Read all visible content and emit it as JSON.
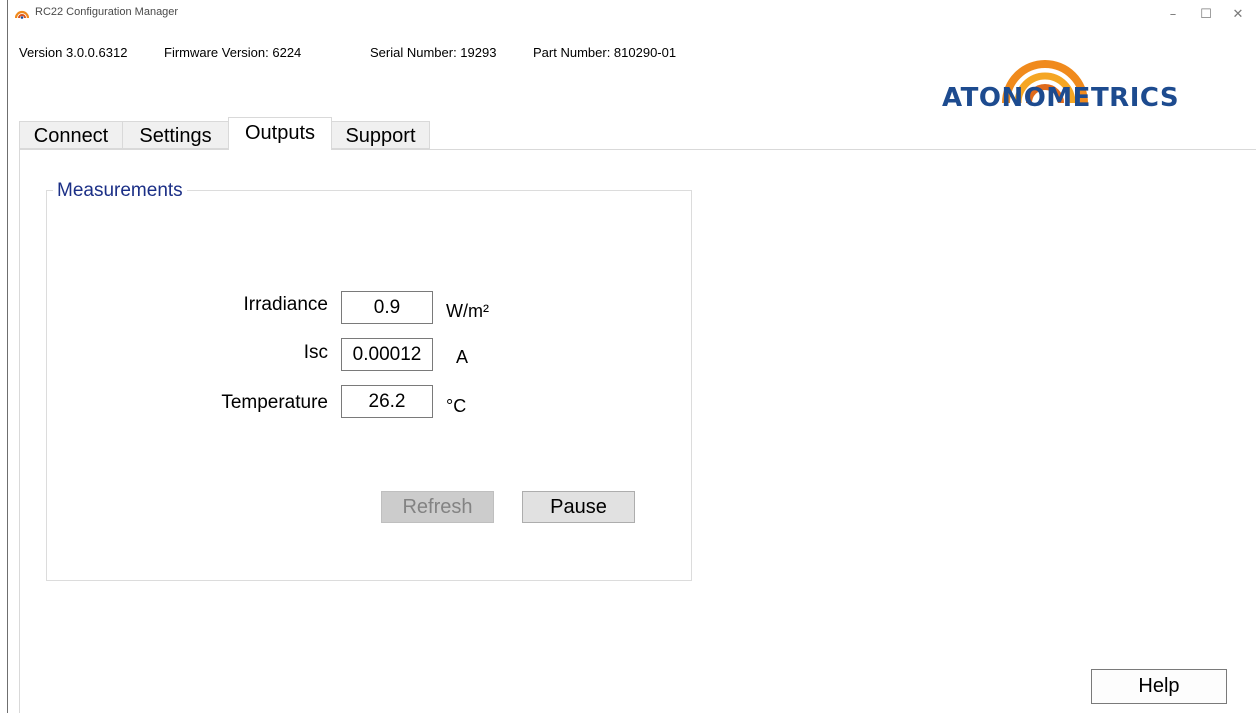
{
  "window": {
    "title": "RC22 Configuration Manager",
    "minimize": "–",
    "maximize": "☐",
    "close": "✕"
  },
  "info": {
    "version": "Version 3.0.0.6312",
    "firmware": "Firmware Version: 6224",
    "serial": "Serial Number: 19293",
    "part": "Part Number: 810290-01"
  },
  "logo": {
    "text": "ATONOMETRICS"
  },
  "tabs": [
    {
      "label": "Connect",
      "active": false
    },
    {
      "label": "Settings",
      "active": false
    },
    {
      "label": "Outputs",
      "active": true
    },
    {
      "label": "Support",
      "active": false
    }
  ],
  "measurements": {
    "title": "Measurements",
    "irradiance": {
      "label": "Irradiance",
      "value": "0.9",
      "unit": "W/m²"
    },
    "isc": {
      "label": "Isc",
      "value": "0.00012",
      "unit": "A"
    },
    "temperature": {
      "label": "Temperature",
      "value": "26.2",
      "unit": "°C"
    },
    "refresh_label": "Refresh",
    "pause_label": "Pause"
  },
  "help_label": "Help",
  "colors": {
    "logo_blue": "#1d4b8f",
    "logo_orange": "#f08a1c",
    "group_title": "#1b2f86"
  }
}
